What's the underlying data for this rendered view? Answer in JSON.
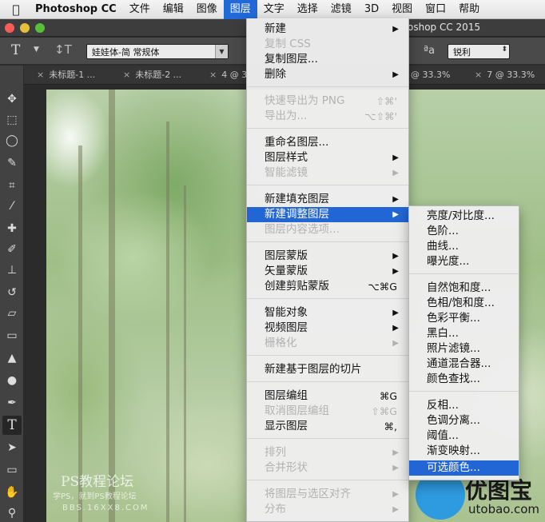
{
  "menubar": {
    "apple_icon": "apple-logo-icon",
    "app_name": "Photoshop CC",
    "items": [
      "文件",
      "编辑",
      "图像",
      "图层",
      "文字",
      "选择",
      "滤镜",
      "3D",
      "视图",
      "窗口",
      "帮助"
    ],
    "active": "图层"
  },
  "window": {
    "title": "oshop CC 2015"
  },
  "options": {
    "font_name": "娃娃体-简 常规体",
    "aa_label": "ªa",
    "antialias": "锐利"
  },
  "tabs": [
    {
      "label": "未标题-1 ..."
    },
    {
      "label": "未标题-2 ..."
    },
    {
      "label": "4 @ 3"
    },
    {
      "label": "@ 33.3%"
    },
    {
      "label": "7 @ 33.3%"
    }
  ],
  "layer_menu": {
    "items": [
      {
        "label": "新建",
        "arrow": "▶",
        "enabled": true
      },
      {
        "label": "复制 CSS",
        "enabled": false
      },
      {
        "label": "复制图层...",
        "enabled": true
      },
      {
        "label": "删除",
        "arrow": "▶",
        "enabled": true
      },
      {
        "label": "快速导出为 PNG",
        "shortcut": "⇧⌘'",
        "enabled": false
      },
      {
        "label": "导出为...",
        "shortcut": "⌥⇧⌘'",
        "enabled": false
      },
      {
        "label": "重命名图层...",
        "enabled": true
      },
      {
        "label": "图层样式",
        "arrow": "▶",
        "enabled": true
      },
      {
        "label": "智能滤镜",
        "arrow": "▶",
        "enabled": false
      },
      {
        "label": "新建填充图层",
        "arrow": "▶",
        "enabled": true
      },
      {
        "label": "新建调整图层",
        "arrow": "▶",
        "enabled": true,
        "highlight": true
      },
      {
        "label": "图层内容选项...",
        "enabled": false
      },
      {
        "label": "图层蒙版",
        "arrow": "▶",
        "enabled": true
      },
      {
        "label": "矢量蒙版",
        "arrow": "▶",
        "enabled": true
      },
      {
        "label": "创建剪贴蒙版",
        "shortcut": "⌥⌘G",
        "enabled": true
      },
      {
        "label": "智能对象",
        "arrow": "▶",
        "enabled": true
      },
      {
        "label": "视频图层",
        "arrow": "▶",
        "enabled": true
      },
      {
        "label": "栅格化",
        "arrow": "▶",
        "enabled": false
      },
      {
        "label": "新建基于图层的切片",
        "enabled": true
      },
      {
        "label": "图层编组",
        "shortcut": "⌘G",
        "enabled": true
      },
      {
        "label": "取消图层编组",
        "shortcut": "⇧⌘G",
        "enabled": false
      },
      {
        "label": "显示图层",
        "shortcut": "⌘,",
        "enabled": true
      },
      {
        "label": "排列",
        "arrow": "▶",
        "enabled": false
      },
      {
        "label": "合并形状",
        "arrow": "▶",
        "enabled": false
      },
      {
        "label": "将图层与选区对齐",
        "arrow": "▶",
        "enabled": false
      },
      {
        "label": "分布",
        "arrow": "▶",
        "enabled": false
      }
    ]
  },
  "adjust_menu": {
    "items": [
      {
        "label": "亮度/对比度..."
      },
      {
        "label": "色阶..."
      },
      {
        "label": "曲线..."
      },
      {
        "label": "曝光度..."
      },
      {
        "label": "自然饱和度..."
      },
      {
        "label": "色相/饱和度..."
      },
      {
        "label": "色彩平衡..."
      },
      {
        "label": "黑白..."
      },
      {
        "label": "照片滤镜..."
      },
      {
        "label": "通道混合器..."
      },
      {
        "label": "颜色查找..."
      },
      {
        "label": "反相..."
      },
      {
        "label": "色调分离..."
      },
      {
        "label": "阈值..."
      },
      {
        "label": "渐变映射..."
      },
      {
        "label": "可选颜色...",
        "highlight": true
      }
    ]
  },
  "watermark": {
    "title": "PS教程论坛",
    "line1": "学PS，就到PS教程论坛",
    "line2": "BBS.16XX8.COM"
  },
  "logo": {
    "name": "优图宝",
    "domain": "utobao.com"
  },
  "colors": {
    "highlight": "#2266d5",
    "menubar_bg": "#e8e8e8",
    "toolbar_bg": "#424242"
  }
}
